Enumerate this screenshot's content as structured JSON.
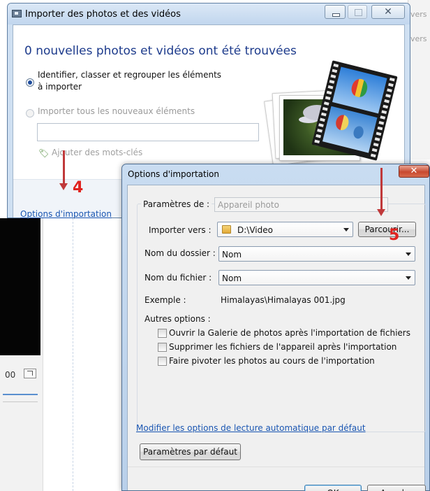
{
  "background": {
    "right_text_1": "vers la",
    "right_text_2": "vers la",
    "zoom_text": "00"
  },
  "import_window": {
    "title": "Importer des photos et des vidéos",
    "heading": "0 nouvelles photos et vidéos ont été trouvées",
    "option_identify": "Identifier, classer et regrouper les éléments à importer",
    "option_import_all": "Importer tous les nouveaux éléments",
    "tag_input_value": "",
    "add_keywords": "Ajouter des mots-clés",
    "options_link": "Options d'importation"
  },
  "options_dialog": {
    "title": "Options d'importation",
    "settings_for_label": "Paramètres de :",
    "settings_for_value": "Appareil photo",
    "import_to_label": "Importer vers :",
    "import_to_value": "D:\\Video",
    "browse_button": "Parcourir...",
    "folder_name_label": "Nom du dossier :",
    "folder_name_value": "Nom",
    "file_name_label": "Nom du fichier :",
    "file_name_value": "Nom",
    "example_label": "Exemple :",
    "example_value": "Himalayas\\Himalayas 001.jpg",
    "other_options_label": "Autres options :",
    "checkboxes": [
      {
        "label": "Ouvrir la Galerie de photos après l'importation de fichiers",
        "checked": false
      },
      {
        "label": "Supprimer les fichiers de l'appareil après l'importation",
        "checked": false
      },
      {
        "label": "Faire pivoter les photos au cours de l'importation",
        "checked": false
      }
    ],
    "autoplay_link": "Modifier les options de lecture automatique par défaut",
    "defaults_button": "Paramètres par défaut",
    "ok_button": "OK",
    "cancel_button": "Annuler"
  },
  "annotations": {
    "step_4": "4",
    "step_5": "5",
    "color": "#e0231f"
  },
  "colors": {
    "heading": "#1d3b8c",
    "link": "#1a56b2",
    "title_bar": "#c9dcf1",
    "close_button": "#c8492f"
  }
}
